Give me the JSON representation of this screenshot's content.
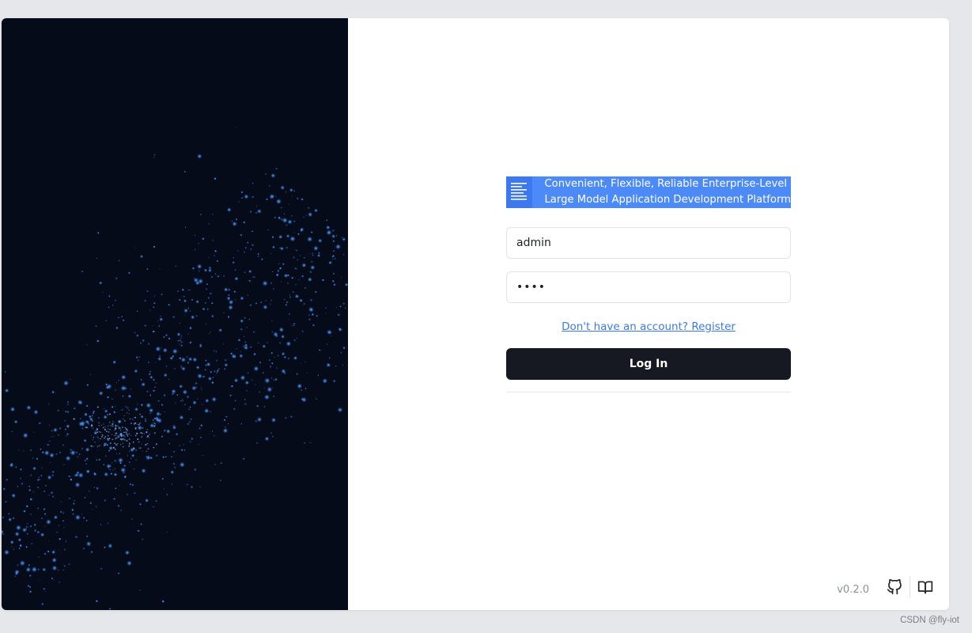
{
  "brand": {
    "logo_icon": "document-lines-icon",
    "tagline_line1": "Convenient, Flexible, Reliable Enterprise-Level",
    "tagline_line2": "Large Model Application Development Platform"
  },
  "login_form": {
    "username_value": "admin",
    "password_value": "••••",
    "register_link": "Don't have an account? Register",
    "login_button": "Log In"
  },
  "footer": {
    "version": "v0.2.0",
    "github_icon": "github-icon",
    "docs_icon": "book-icon"
  },
  "watermark": "CSDN @fly-iot",
  "colors": {
    "accent": "#4b8af7",
    "button_bg": "#161922",
    "left_panel_bg": "#050b18",
    "particles": "#3f8cff",
    "link": "#3b7be0"
  }
}
